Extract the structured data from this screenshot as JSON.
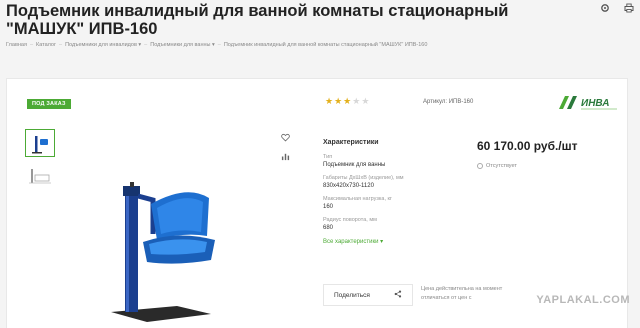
{
  "product": {
    "title": "Подъемник инвалидный для ванной комнаты стационарный \"МАШУК\" ИПВ-160",
    "badge": "ПОД ЗАКАЗ",
    "article": "Артикул: ИПВ-160",
    "rating": 3,
    "rating_max": 5,
    "price": "60 170.00 руб./шт",
    "stock": "Отсутствует"
  },
  "breadcrumb": [
    "Главная",
    "Каталог",
    "Подъемники для инвалидов",
    "Подъемники для ванны",
    "Подъемник инвалидный для ванной комнаты стационарный \"МАШУК\" ИПВ-160"
  ],
  "specs": {
    "heading": "Характеристики",
    "items": [
      {
        "label": "Тип",
        "value": "Подъемник для ванны"
      },
      {
        "label": "Габариты ДхШхВ (изделие), мм",
        "value": "830x420x730-1120"
      },
      {
        "label": "Максимальная нагрузка, кг",
        "value": "160"
      },
      {
        "label": "Радиус поворота, мм",
        "value": "680"
      }
    ],
    "all_link": "Все характеристики"
  },
  "share": {
    "label": "Поделиться"
  },
  "note": {
    "line1": "Цена действительна на момент",
    "line2": "отличаться от цен с"
  },
  "logo": {
    "text": "ИНВА"
  },
  "watermark": "YAPLAKAL.COM",
  "colors": {
    "accent": "#4caa35",
    "star_on": "#e3b01c",
    "star_off": "#d8d8d8",
    "seat_blue": "#1e6fd0",
    "frame_blue": "#1b3f8f"
  }
}
